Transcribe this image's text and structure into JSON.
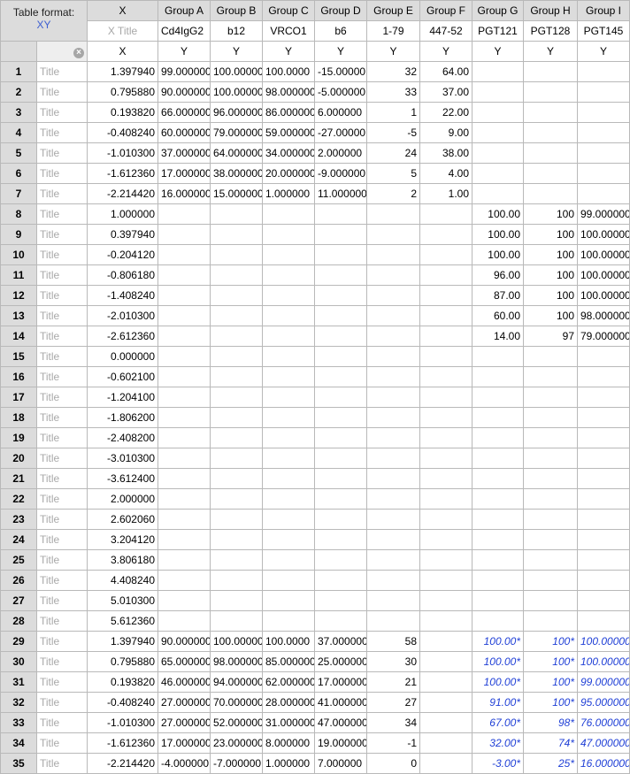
{
  "table_format_label": "Table format:",
  "table_format_value": "XY",
  "col_headers": [
    "X",
    "Group A",
    "Group B",
    "Group C",
    "Group D",
    "Group E",
    "Group F",
    "Group G",
    "Group H",
    "Group I"
  ],
  "x_title_placeholder": "X Title",
  "col_titles": [
    "Cd4IgG2",
    "b12",
    "VRCO1",
    "b6",
    "1-79",
    "447-52",
    "PGT121",
    "PGT128",
    "PGT145"
  ],
  "sub_headers": [
    "X",
    "Y",
    "Y",
    "Y",
    "Y",
    "Y",
    "Y",
    "Y",
    "Y",
    "Y"
  ],
  "row_title_placeholder": "Title",
  "rows": [
    {
      "n": "1",
      "x": "1.397940",
      "v": [
        "99.000000",
        "100.00000",
        "100.0000",
        "-15.00000",
        "32",
        "64.00",
        "",
        "",
        ""
      ]
    },
    {
      "n": "2",
      "x": "0.795880",
      "v": [
        "90.000000",
        "100.00000",
        "98.000000",
        "-5.000000",
        "33",
        "37.00",
        "",
        "",
        ""
      ]
    },
    {
      "n": "3",
      "x": "0.193820",
      "v": [
        "66.000000",
        "96.000000",
        "86.000000",
        "6.000000",
        "1",
        "22.00",
        "",
        "",
        ""
      ]
    },
    {
      "n": "4",
      "x": "-0.408240",
      "v": [
        "60.000000",
        "79.000000",
        "59.000000",
        "-27.00000",
        "-5",
        "9.00",
        "",
        "",
        ""
      ]
    },
    {
      "n": "5",
      "x": "-1.010300",
      "v": [
        "37.000000",
        "64.000000",
        "34.000000",
        "2.000000",
        "24",
        "38.00",
        "",
        "",
        ""
      ]
    },
    {
      "n": "6",
      "x": "-1.612360",
      "v": [
        "17.000000",
        "38.000000",
        "20.000000",
        "-9.000000",
        "5",
        "4.00",
        "",
        "",
        ""
      ]
    },
    {
      "n": "7",
      "x": "-2.214420",
      "v": [
        "16.000000",
        "15.000000",
        "1.000000",
        "11.000000",
        "2",
        "1.00",
        "",
        "",
        ""
      ]
    },
    {
      "n": "8",
      "x": "1.000000",
      "v": [
        "",
        "",
        "",
        "",
        "",
        "",
        "100.00",
        "100",
        "99.000000"
      ]
    },
    {
      "n": "9",
      "x": "0.397940",
      "v": [
        "",
        "",
        "",
        "",
        "",
        "",
        "100.00",
        "100",
        "100.00000"
      ]
    },
    {
      "n": "10",
      "x": "-0.204120",
      "v": [
        "",
        "",
        "",
        "",
        "",
        "",
        "100.00",
        "100",
        "100.00000"
      ]
    },
    {
      "n": "11",
      "x": "-0.806180",
      "v": [
        "",
        "",
        "",
        "",
        "",
        "",
        "96.00",
        "100",
        "100.00000"
      ]
    },
    {
      "n": "12",
      "x": "-1.408240",
      "v": [
        "",
        "",
        "",
        "",
        "",
        "",
        "87.00",
        "100",
        "100.00000"
      ]
    },
    {
      "n": "13",
      "x": "-2.010300",
      "v": [
        "",
        "",
        "",
        "",
        "",
        "",
        "60.00",
        "100",
        "98.000000"
      ]
    },
    {
      "n": "14",
      "x": "-2.612360",
      "v": [
        "",
        "",
        "",
        "",
        "",
        "",
        "14.00",
        "97",
        "79.000000"
      ]
    },
    {
      "n": "15",
      "x": "0.000000",
      "v": [
        "",
        "",
        "",
        "",
        "",
        "",
        "",
        "",
        ""
      ]
    },
    {
      "n": "16",
      "x": "-0.602100",
      "v": [
        "",
        "",
        "",
        "",
        "",
        "",
        "",
        "",
        ""
      ]
    },
    {
      "n": "17",
      "x": "-1.204100",
      "v": [
        "",
        "",
        "",
        "",
        "",
        "",
        "",
        "",
        ""
      ]
    },
    {
      "n": "18",
      "x": "-1.806200",
      "v": [
        "",
        "",
        "",
        "",
        "",
        "",
        "",
        "",
        ""
      ]
    },
    {
      "n": "19",
      "x": "-2.408200",
      "v": [
        "",
        "",
        "",
        "",
        "",
        "",
        "",
        "",
        ""
      ]
    },
    {
      "n": "20",
      "x": "-3.010300",
      "v": [
        "",
        "",
        "",
        "",
        "",
        "",
        "",
        "",
        ""
      ]
    },
    {
      "n": "21",
      "x": "-3.612400",
      "v": [
        "",
        "",
        "",
        "",
        "",
        "",
        "",
        "",
        ""
      ]
    },
    {
      "n": "22",
      "x": "2.000000",
      "v": [
        "",
        "",
        "",
        "",
        "",
        "",
        "",
        "",
        ""
      ]
    },
    {
      "n": "23",
      "x": "2.602060",
      "v": [
        "",
        "",
        "",
        "",
        "",
        "",
        "",
        "",
        ""
      ]
    },
    {
      "n": "24",
      "x": "3.204120",
      "v": [
        "",
        "",
        "",
        "",
        "",
        "",
        "",
        "",
        ""
      ]
    },
    {
      "n": "25",
      "x": "3.806180",
      "v": [
        "",
        "",
        "",
        "",
        "",
        "",
        "",
        "",
        ""
      ]
    },
    {
      "n": "26",
      "x": "4.408240",
      "v": [
        "",
        "",
        "",
        "",
        "",
        "",
        "",
        "",
        ""
      ]
    },
    {
      "n": "27",
      "x": "5.010300",
      "v": [
        "",
        "",
        "",
        "",
        "",
        "",
        "",
        "",
        ""
      ]
    },
    {
      "n": "28",
      "x": "5.612360",
      "v": [
        "",
        "",
        "",
        "",
        "",
        "",
        "",
        "",
        ""
      ]
    },
    {
      "n": "29",
      "x": "1.397940",
      "v": [
        "90.000000",
        "100.00000",
        "100.0000",
        "37.000000",
        "58",
        "",
        "100.00*",
        "100*",
        "100.00000"
      ],
      "blue": true
    },
    {
      "n": "30",
      "x": "0.795880",
      "v": [
        "65.000000",
        "98.000000",
        "85.000000",
        "25.000000",
        "30",
        "",
        "100.00*",
        "100*",
        "100.00000"
      ],
      "blue": true
    },
    {
      "n": "31",
      "x": "0.193820",
      "v": [
        "46.000000",
        "94.000000",
        "62.000000",
        "17.000000",
        "21",
        "",
        "100.00*",
        "100*",
        "99.000000"
      ],
      "blue": true
    },
    {
      "n": "32",
      "x": "-0.408240",
      "v": [
        "27.000000",
        "70.000000",
        "28.000000",
        "41.000000",
        "27",
        "",
        "91.00*",
        "100*",
        "95.000000"
      ],
      "blue": true
    },
    {
      "n": "33",
      "x": "-1.010300",
      "v": [
        "27.000000",
        "52.000000",
        "31.000000",
        "47.000000",
        "34",
        "",
        "67.00*",
        "98*",
        "76.000000"
      ],
      "blue": true
    },
    {
      "n": "34",
      "x": "-1.612360",
      "v": [
        "17.000000",
        "23.000000",
        "8.000000",
        "19.000000",
        "-1",
        "",
        "32.00*",
        "74*",
        "47.000000"
      ],
      "blue": true
    },
    {
      "n": "35",
      "x": "-2.214420",
      "v": [
        "-4.000000",
        "-7.000000",
        "1.000000",
        "7.000000",
        "0",
        "",
        "-3.00*",
        "25*",
        "16.000000"
      ],
      "blue": true
    }
  ]
}
